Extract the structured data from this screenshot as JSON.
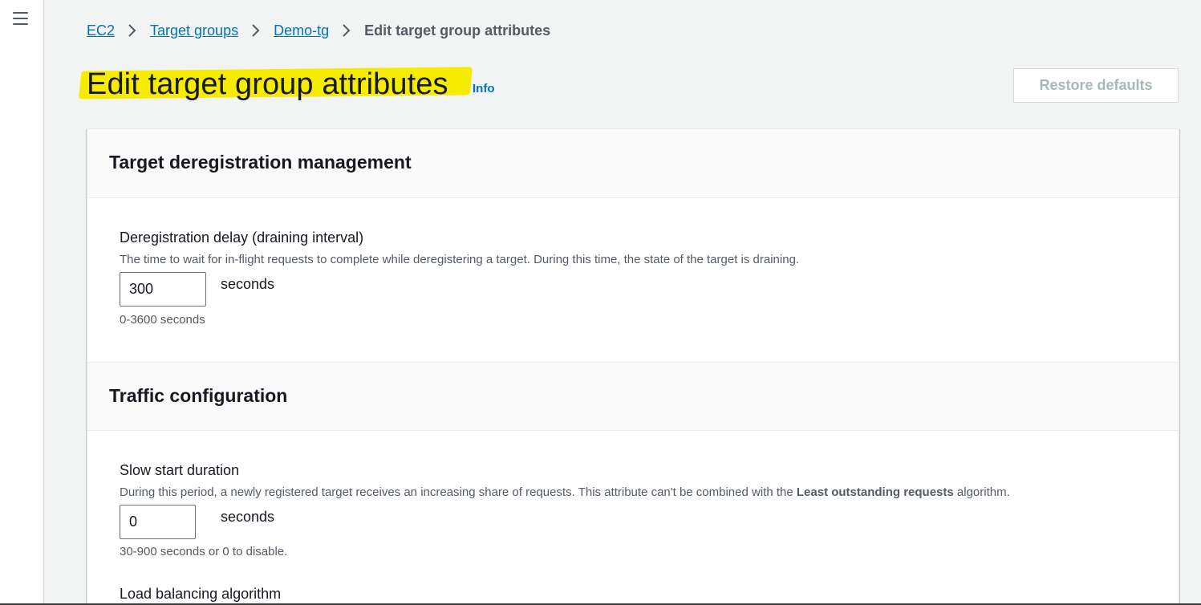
{
  "nav": {
    "menu_icon": "hamburger-menu-icon"
  },
  "breadcrumb": {
    "items": [
      {
        "label": "EC2"
      },
      {
        "label": "Target groups"
      },
      {
        "label": "Demo-tg"
      }
    ],
    "current": "Edit target group attributes",
    "separator_icon": "chevron-right-icon"
  },
  "header": {
    "title": "Edit target group attributes",
    "info": "Info",
    "highlight_color": "#f5ec00",
    "restore_label": "Restore defaults"
  },
  "sections": [
    {
      "title": "Target deregistration management",
      "fields": [
        {
          "label": "Deregistration delay (draining interval)",
          "description": "The time to wait for in-flight requests to complete while deregistering a target. During this time, the state of the target is draining.",
          "value": "300",
          "unit": "seconds",
          "constraint": "0-3600 seconds"
        }
      ]
    },
    {
      "title": "Traffic configuration",
      "fields": [
        {
          "label": "Slow start duration",
          "description_pre": "During this period, a newly registered target receives an increasing share of requests. This attribute can't be combined with the ",
          "description_bold": "Least outstanding requests",
          "description_post": " algorithm.",
          "value": "0",
          "unit": "seconds",
          "constraint": "30-900 seconds or 0 to disable."
        },
        {
          "label": "Load balancing algorithm"
        }
      ]
    }
  ],
  "colors": {
    "link": "#0073bb",
    "background": "#f2f3f3",
    "text": "#16191f",
    "secondary_text": "#545b64",
    "disabled_button_text": "#aab7b8"
  }
}
